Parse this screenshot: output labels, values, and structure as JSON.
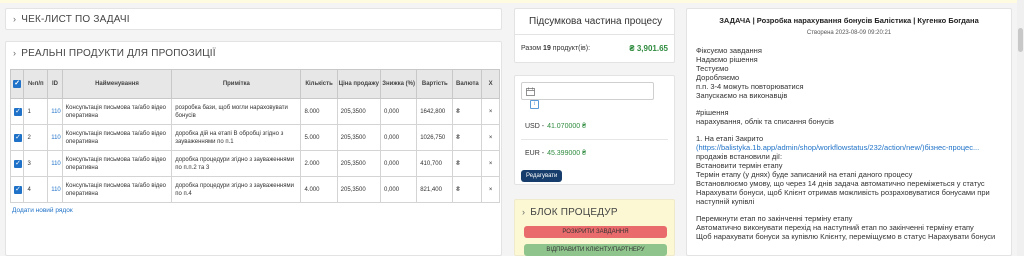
{
  "checklist": {
    "title": "ЧЕК-ЛИСТ ПО ЗАДАЧІ"
  },
  "products": {
    "title": "РЕАЛЬНІ ПРОДУКТИ ДЛЯ ПРОПОЗИЦІЇ",
    "columns": [
      "№п/п",
      "ID",
      "Найменування",
      "Примітка",
      "Кількість",
      "Ціна продажу",
      "Знижка (%)",
      "Вартість",
      "Валюта",
      "Х"
    ],
    "rows": [
      {
        "n": "1",
        "id": "110",
        "name": "Консультація письмова та/або відео оперативна",
        "note": "розробка бази, щоб могли нараховувати бонусів",
        "qty": "8.000",
        "price": "205,3500",
        "discount": "0,000",
        "cost": "1642,800",
        "currency": "₴",
        "del": "×"
      },
      {
        "n": "2",
        "id": "110",
        "name": "Консультація письмова та/або відео оперативна",
        "note": "доробка дій на етапі В обробці згідно з зауваженнями по п.1",
        "qty": "5.000",
        "price": "205,3500",
        "discount": "0,000",
        "cost": "1026,750",
        "currency": "₴",
        "del": "×"
      },
      {
        "n": "3",
        "id": "110",
        "name": "Консультація письмова та/або відео оперативна",
        "note": "доробка процедури згідно з зауваженнями по п.п.2 та 3",
        "qty": "2.000",
        "price": "205,3500",
        "discount": "0,000",
        "cost": "410,700",
        "currency": "₴",
        "del": "×"
      },
      {
        "n": "4",
        "id": "110",
        "name": "Консультація письмова та/або відео оперативна",
        "note": "доробка процедури згідно з зауваженнями по п.4",
        "qty": "4.000",
        "price": "205,3500",
        "discount": "0,000",
        "cost": "821,400",
        "currency": "₴",
        "del": "×"
      }
    ],
    "add_row": "Додати новий рядок"
  },
  "summary": {
    "title": "Підсумкова частина процесу",
    "total_prefix": "Разом",
    "total_count": "19",
    "total_suffix": "продукт(ів):",
    "total_amount": "₴ 3,901.65"
  },
  "currency": {
    "date_placeholder": "",
    "info": "i",
    "usd_label": "USD -",
    "usd_value": "41.070000 ₴",
    "eur_label": "EUR -",
    "eur_value": "45.399000 ₴",
    "edit_button": "Редагувати"
  },
  "procedures": {
    "title": "БЛОК ПРОЦЕДУР",
    "btn_split": "РОЗКРИТИ ЗАВДАННЯ",
    "btn_return": "ВІДПРАВИТИ КЛІЄНТУ/ПАРТНЕРУ"
  },
  "task": {
    "title": "ЗАДАЧА | Розробка нарахування бонусів Балістика | Кугенко Богдана",
    "created": "Створена 2023-08-09 09:20:21",
    "lines": [
      "Фіксуємо завдання",
      "Надаємо рішення",
      "Тестуємо",
      "Доробляємо",
      "п.п. 3-4 можуть повторюватися",
      "Запускаємо на виконавців"
    ],
    "hash": "#рішення",
    "hash_line": "нарахування, облік та списання бонусів",
    "stage1_title": "1. На етапі Закрито",
    "stage1_link": "(https://balistyka.1b.app/admin/shop/workflowstatus/232/action/new/)бізнес-процес...",
    "stage1_lines": [
      "продажів встановили дії:",
      "Встановити термін етапу",
      "Термін етапу (у днях) буде записаний на етапі даного процесу",
      "Встановлюємо умову, що через 14 днів задача автоматично переміжеться у статус",
      "Нарахувати бонуси, щоб Клієнт отримав можливість розраховуватися бонусами при",
      "наступній купівлі"
    ],
    "stage2_lines": [
      "Перемкнути етап по закінченні терміну етапу",
      "Автоматично виконувати перехід на наступний етап по закінченні терміну етапу",
      "Щоб нарахувати бонуси за купівлю Клієнту, переміщуємо в статус Нарахувати бонуси"
    ]
  },
  "icons": {
    "chevron": "chevron-right-icon",
    "calendar": "calendar-icon",
    "info": "info-icon",
    "checkbox": "checkbox-checked-icon",
    "delete": "close-icon"
  },
  "colors": {
    "accent_blue": "#1f72c8",
    "amount_green": "#2e8b3e",
    "proc_bg": "#fbf8d3",
    "btn_red": "#e96b6b",
    "btn_green": "#8fc58c",
    "btn_dark": "#163d6b"
  }
}
